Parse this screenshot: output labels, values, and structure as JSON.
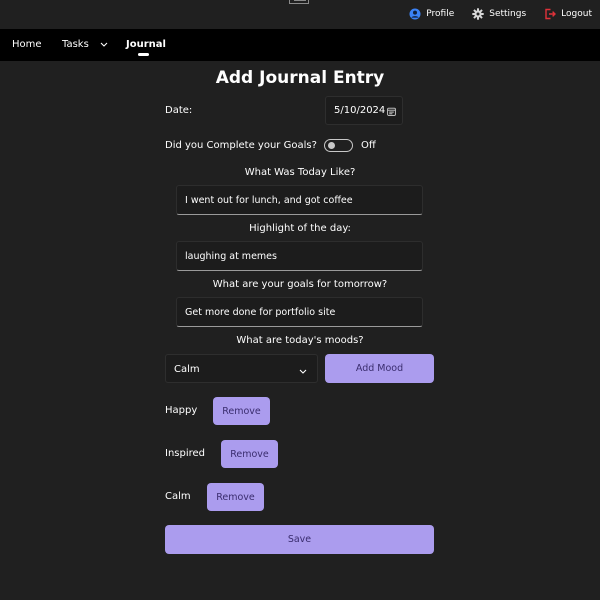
{
  "header": {
    "profile_label": "Profile",
    "settings_label": "Settings",
    "logout_label": "Logout"
  },
  "nav": {
    "home": "Home",
    "tasks": "Tasks",
    "journal": "Journal",
    "active": "Journal"
  },
  "page": {
    "title": "Add Journal Entry"
  },
  "form": {
    "date_label": "Date:",
    "date_value": "5/10/2024",
    "goals_label": "Did you Complete your Goals?",
    "goals_toggle_state": "Off",
    "today_label": "What Was Today Like?",
    "today_value": "I went out for lunch, and got coffee",
    "highlight_label": "Highlight of the day:",
    "highlight_value": "laughing at memes",
    "tomorrow_label": "What are your goals for tomorrow?",
    "tomorrow_value": "Get more done for portfolio site",
    "moods_label": "What are today's moods?",
    "mood_select_value": "Calm",
    "add_mood_label": "Add Mood",
    "save_label": "Save"
  },
  "moods": [
    {
      "name": "Happy",
      "remove_label": "Remove"
    },
    {
      "name": "Inspired",
      "remove_label": "Remove"
    },
    {
      "name": "Calm",
      "remove_label": "Remove"
    }
  ],
  "colors": {
    "background": "#202020",
    "nav_background": "#000000",
    "accent": "#ab9cee",
    "accent_text": "#3a2d6e",
    "profile_icon": "#3b82f6",
    "logout_icon": "#e0323a"
  }
}
